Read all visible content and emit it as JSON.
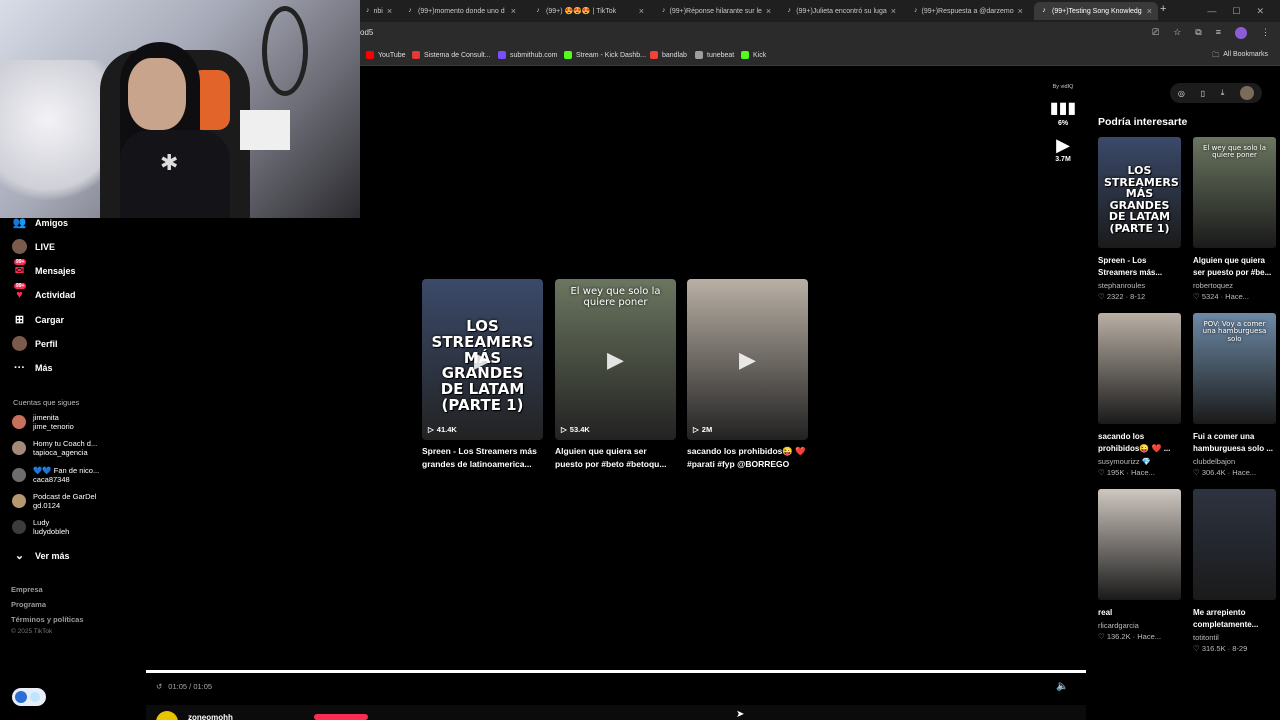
{
  "browser": {
    "tabs": [
      {
        "label": "nbi",
        "active": false
      },
      {
        "label": "(99+)momento donde uno d",
        "active": false
      },
      {
        "label": "(99+) 😍😍😍 | TikTok",
        "active": false
      },
      {
        "label": "(99+)Réponse hilarante sur le",
        "active": false
      },
      {
        "label": "(99+)Julieta encontró su luga",
        "active": false
      },
      {
        "label": "(99+)Respuesta a @darzemo",
        "active": false
      },
      {
        "label": "(99+)Testing Song Knowledg",
        "active": true
      }
    ],
    "new_tab": "+",
    "url": "od5",
    "bookmarks": [
      {
        "label": "YouTube",
        "color": "#ff0000"
      },
      {
        "label": "Sistema de Consult...",
        "color": "#e53935"
      },
      {
        "label": "submithub.com",
        "color": "#7c4dff"
      },
      {
        "label": "Stream - Kick Dashb...",
        "color": "#53fc18"
      },
      {
        "label": "bandlab",
        "color": "#f44336"
      },
      {
        "label": "tunebeat",
        "color": "#9e9e9e"
      },
      {
        "label": "Kick",
        "color": "#53fc18"
      }
    ],
    "all_bookmarks": "All Bookmarks"
  },
  "sidebar": {
    "nav": [
      {
        "label": "Amigos",
        "icon": "friends-icon",
        "glyph": "👥",
        "badge": ""
      },
      {
        "label": "LIVE",
        "icon": "live-icon",
        "glyph": "●",
        "badge": ""
      },
      {
        "label": "Mensajes",
        "icon": "messages-icon",
        "glyph": "✉",
        "badge": "99+"
      },
      {
        "label": "Actividad",
        "icon": "activity-icon",
        "glyph": "♥",
        "badge": "99+"
      },
      {
        "label": "Cargar",
        "icon": "upload-icon",
        "glyph": "⊞",
        "badge": ""
      },
      {
        "label": "Perfil",
        "icon": "profile-icon",
        "glyph": "●",
        "badge": ""
      },
      {
        "label": "Más",
        "icon": "more-icon",
        "glyph": "···",
        "badge": ""
      }
    ],
    "following_title": "Cuentas que sigues",
    "following": [
      {
        "name": "jimenita",
        "handle": "jime_tenorio",
        "color": "#c7705a"
      },
      {
        "name": "Homy tu Coach d...",
        "handle": "tapioca_agencia",
        "color": "#a58a7a"
      },
      {
        "name": "💙💙 Fan de nico...",
        "handle": "caca87348",
        "color": "#6d6d6d"
      },
      {
        "name": "Podcast de GarDel",
        "handle": "gd.0124",
        "color": "#b59870"
      },
      {
        "name": "Ludy",
        "handle": "ludydobleh",
        "color": "#3c3c3c"
      }
    ],
    "see_more": "Ver más",
    "footer_links": [
      "Empresa",
      "Programa",
      "Términos y políticas"
    ],
    "copyright": "© 2025 TikTok"
  },
  "end_screen": [
    {
      "views": "41.4K",
      "caption_line1": "Spreen - Los Streamers más",
      "caption_line2": "grandes de latinoamerica...",
      "bg": "#3b4a6a",
      "overlay": "LOS STREAMERS MÁS GRANDES DE LATAM (PARTE 1)"
    },
    {
      "views": "53.4K",
      "caption_line1": "Alguien que quiera ser",
      "caption_line2": "puesto por #beto #betoqu...",
      "bg": "#6b7660",
      "overlay": "El wey que solo la quiere poner"
    },
    {
      "views": "2M",
      "caption_line1": "sacando los prohibidos😜 ❤️",
      "caption_line2": "#parati #fyp @BORREGO",
      "bg": "#b9b0a5",
      "overlay": ""
    }
  ],
  "vidiq": {
    "by": "By vidIQ",
    "percent": "6%",
    "views": "3.7M"
  },
  "recommendations": {
    "title": "Podría interesarte",
    "items": [
      {
        "caption_line1": "Spreen - Los",
        "caption_line2": "Streamers más...",
        "user": "stephanroules",
        "likes": "2322",
        "date": "8-12",
        "bg": "#3b4a6a",
        "overlay": "LOS STREAMERS MÁS GRANDES DE LATAM (PARTE 1)"
      },
      {
        "caption_line1": "Alguien que quiera",
        "caption_line2": "ser puesto por #be...",
        "user": "robertoquez",
        "likes": "5324",
        "date": "Hace...",
        "bg": "#6b7660",
        "overlay": "El wey que solo la quiere poner"
      },
      {
        "caption_line1": "sacando los",
        "caption_line2": "prohibidos😜 ❤️ ...",
        "user": "susymourizz 💎",
        "likes": "195K",
        "date": "Hace...",
        "bg": "#b9b0a5",
        "overlay": ""
      },
      {
        "caption_line1": "Fui a comer una",
        "caption_line2": "hamburguesa solo ...",
        "user": "clubdelbajon",
        "likes": "306.4K",
        "date": "Hace...",
        "bg": "#6d8aa6",
        "overlay": "POV: Voy a comer una hamburguesa solo"
      },
      {
        "caption_line1": "real",
        "caption_line2": "",
        "user": "rlicardgarcia",
        "likes": "136.2K",
        "date": "Hace...",
        "bg": "#cfc7c0",
        "overlay": ""
      },
      {
        "caption_line1": "Me arrepiento",
        "caption_line2": "completamente...",
        "user": "totitontil",
        "likes": "316.5K",
        "date": "8-29",
        "bg": "#2d3340",
        "overlay": ""
      }
    ]
  },
  "player": {
    "time": "01:05 / 01:05",
    "progress": 1.0,
    "username": "zoneomohh"
  }
}
